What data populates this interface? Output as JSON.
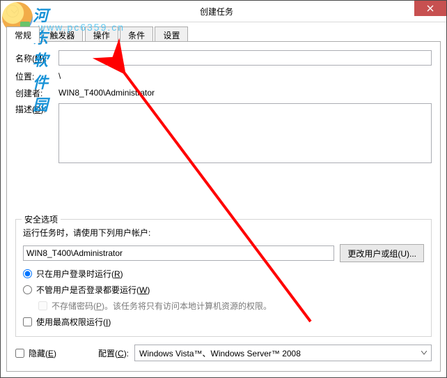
{
  "window": {
    "title": "创建任务"
  },
  "tabs": {
    "general": "常规",
    "triggers": "触发器",
    "actions": "操作",
    "conditions": "条件",
    "settings": "设置"
  },
  "form": {
    "name_label_prefix": "名称(",
    "name_label_key": "M",
    "name_label_suffix": "):",
    "name_value": "",
    "location_label": "位置:",
    "location_value": "\\",
    "creator_label": "创建者:",
    "creator_value": "WIN8_T400\\Administrator",
    "desc_label_prefix": "描述(",
    "desc_label_key": "D",
    "desc_label_suffix": "):",
    "desc_value": ""
  },
  "security": {
    "legend": "安全选项",
    "run_as_label": "运行任务时，请使用下列用户帐户:",
    "account": "WIN8_T400\\Administrator",
    "change_user_label": "更改用户或组(U)...",
    "radio_logged_on_prefix": "只在用户登录时运行(",
    "radio_logged_on_key": "R",
    "radio_logged_on_suffix": ")",
    "radio_any_prefix": "不管用户是否登录都要运行(",
    "radio_any_key": "W",
    "radio_any_suffix": ")",
    "no_store_pw_prefix": "不存储密码(",
    "no_store_pw_key": "P",
    "no_store_pw_suffix": ")。该任务将只有访问本地计算机资源的权限。",
    "highest_priv_prefix": "使用最高权限运行(",
    "highest_priv_key": "I",
    "highest_priv_suffix": ")"
  },
  "bottom": {
    "hidden_prefix": "隐藏(",
    "hidden_key": "E",
    "hidden_suffix": ")",
    "config_label_prefix": "配置(",
    "config_label_key": "C",
    "config_label_suffix": "):",
    "config_value": "Windows Vista™、Windows Server™ 2008"
  },
  "watermark": {
    "text1": "河东软件园",
    "text2": "www.pc6359.cn"
  }
}
